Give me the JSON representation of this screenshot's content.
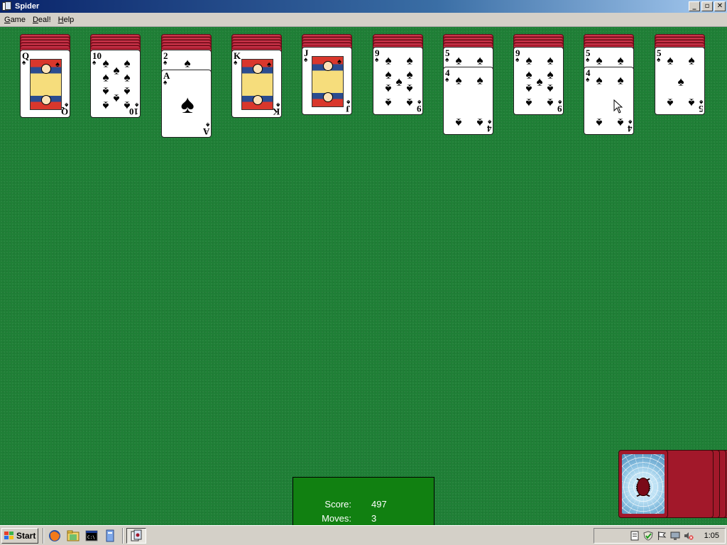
{
  "window": {
    "title": "Spider",
    "controls": [
      "minimize",
      "maximize",
      "close"
    ]
  },
  "menu": [
    {
      "label_pre": "",
      "label_u": "G",
      "label_post": "ame"
    },
    {
      "label_pre": "",
      "label_u": "D",
      "label_post": "eal!"
    },
    {
      "label_pre": "",
      "label_u": "H",
      "label_post": "elp"
    }
  ],
  "tableau": [
    {
      "hidden": 5,
      "cards": [
        {
          "rank": "Q",
          "suit": "♠",
          "face": true
        }
      ]
    },
    {
      "hidden": 5,
      "cards": [
        {
          "rank": "10",
          "suit": "♠"
        }
      ]
    },
    {
      "hidden": 5,
      "cards": [
        {
          "rank": "2",
          "suit": "♠"
        },
        {
          "rank": "A",
          "suit": "♠"
        }
      ]
    },
    {
      "hidden": 5,
      "cards": [
        {
          "rank": "K",
          "suit": "♠",
          "face": true
        }
      ]
    },
    {
      "hidden": 4,
      "cards": [
        {
          "rank": "J",
          "suit": "♠",
          "face": true
        }
      ]
    },
    {
      "hidden": 4,
      "cards": [
        {
          "rank": "9",
          "suit": "♠"
        }
      ]
    },
    {
      "hidden": 4,
      "cards": [
        {
          "rank": "5",
          "suit": "♠"
        },
        {
          "rank": "4",
          "suit": "♠"
        }
      ]
    },
    {
      "hidden": 4,
      "cards": [
        {
          "rank": "9",
          "suit": "♠"
        }
      ]
    },
    {
      "hidden": 4,
      "cards": [
        {
          "rank": "5",
          "suit": "♠"
        },
        {
          "rank": "4",
          "suit": "♠"
        }
      ]
    },
    {
      "hidden": 4,
      "cards": [
        {
          "rank": "5",
          "suit": "♠"
        }
      ]
    }
  ],
  "score": {
    "score_label": "Score:",
    "score_value": "497",
    "moves_label": "Moves:",
    "moves_value": "3"
  },
  "stock": {
    "piles_remaining": 5,
    "icon": "spider-web-icon"
  },
  "taskbar": {
    "start_label": "Start",
    "quicklaunch": [
      "firefox-icon",
      "file-explorer-icon",
      "terminal-icon",
      "notepad-icon"
    ],
    "active_task_icon": "spider-solitaire-icon",
    "tray_icons": [
      "network-icon",
      "shield-check-icon",
      "flag-icon",
      "display-icon",
      "volume-muted-icon"
    ],
    "clock": "1:05"
  },
  "colors": {
    "felt": "#1f7f36",
    "score_box": "#118011",
    "card_back": "#a7192b",
    "title_bar": "#0a246a"
  }
}
